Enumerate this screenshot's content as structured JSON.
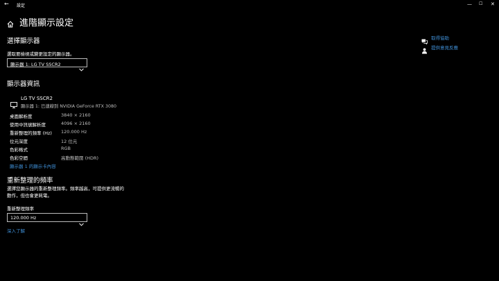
{
  "titlebar": {
    "app_title": "設定",
    "back_glyph": "←",
    "minimize_glyph": "—",
    "maximize_glyph": "☐",
    "close_glyph": "✕"
  },
  "page": {
    "title": "進階顯示設定",
    "icon": "home-icon"
  },
  "select_display": {
    "heading": "選擇顯示器",
    "label": "選取要檢視或變更設定的顯示器。",
    "selected": "顯示器 1: LG TV SSCR2"
  },
  "display_info": {
    "heading": "顯示器資訊",
    "monitor_name": "LG TV SSCR2",
    "monitor_sub": "顯示器 1: 已連線到 NVIDIA GeForce RTX 3080",
    "rows": [
      {
        "key": "桌面解析度",
        "value": "3840 × 2160"
      },
      {
        "key": "使用中訊號解析度",
        "value": "4096 × 2160"
      },
      {
        "key": "重新整理的頻率 (Hz)",
        "value": "120.000 Hz"
      },
      {
        "key": "位元深度",
        "value": "12 位元"
      },
      {
        "key": "色彩格式",
        "value": "RGB"
      },
      {
        "key": "色彩空間",
        "value": "高動態範圍 (HDR)"
      }
    ],
    "adapter_link": "顯示器 1 的顯示卡內容"
  },
  "refresh": {
    "heading": "重新整理的頻率",
    "desc_line1": "選擇您顯示器的重新整理頻率。頻率越高，可提供更流暢的",
    "desc_line2": "動作，但也會更耗電。",
    "label": "重新整理頻率",
    "selected": "120.000 Hz",
    "learn_more": "深入了解"
  },
  "side_links": [
    {
      "label": "取得協助",
      "icon": "help-chat-icon"
    },
    {
      "label": "提供意見反應",
      "icon": "feedback-icon"
    }
  ],
  "colors": {
    "background": "#000000",
    "text": "#ffffff",
    "secondary_text": "#bdbdbd",
    "link": "#3f8fd6",
    "dropdown_border": "#bdbdbd"
  }
}
